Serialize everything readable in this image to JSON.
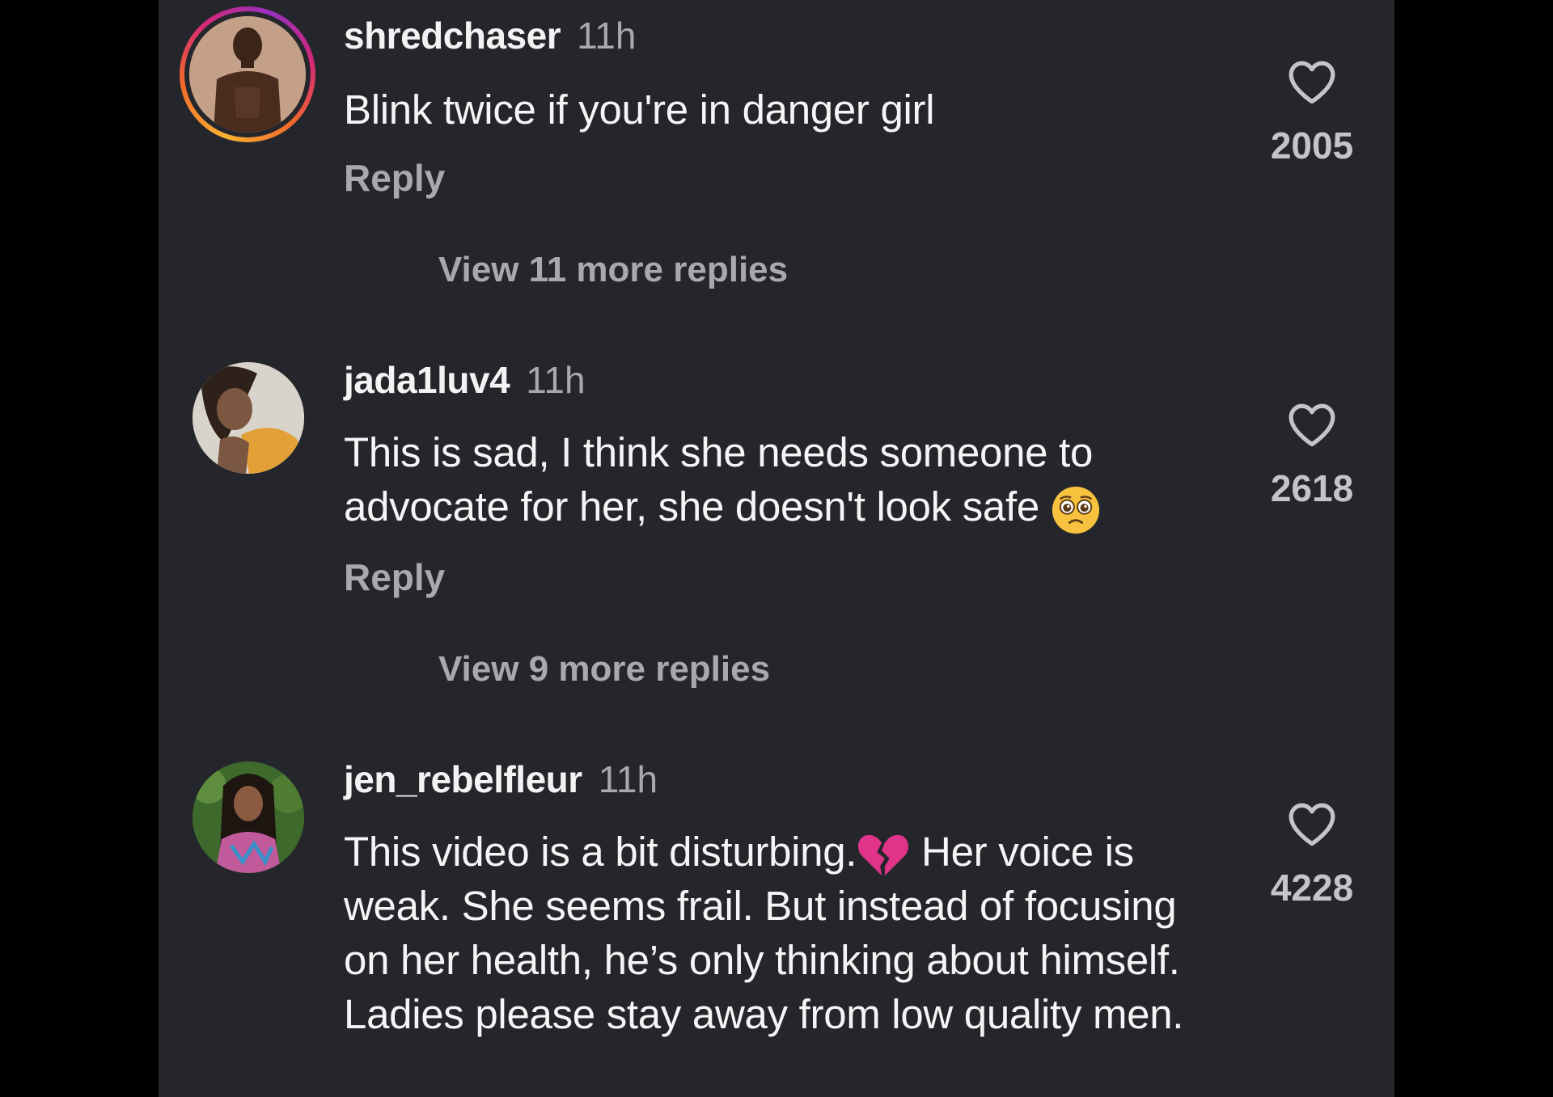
{
  "comments": [
    {
      "username": "shredchaser",
      "time": "11h",
      "text": "Blink twice if you're in danger girl",
      "reply_label": "Reply",
      "view_more": "View 11 more replies",
      "likes": "2005"
    },
    {
      "username": "jada1luv4",
      "time": "11h",
      "text_line1": "This is sad, I think she needs someone to",
      "text_line2": "advocate for her, she doesn't look safe",
      "emoji": "pleading-face",
      "reply_label": "Reply",
      "view_more": "View 9 more replies",
      "likes": "2618"
    },
    {
      "username": "jen_rebelfleur",
      "time": "11h",
      "text_part1": "This video is a bit disturbing.",
      "emoji": "broken-heart",
      "text_part2": " Her voice is weak. She seems frail. But instead of focusing on her health, he’s only thinking about himself. Ladies please stay away from low quality men.",
      "likes": "4228"
    }
  ],
  "icons": {
    "like": "heart-outline-icon"
  },
  "colors": {
    "panel_bg": "#25262b",
    "outer_bg": "#000000",
    "text_primary": "#f5f5f5",
    "text_secondary": "#a8a9ae"
  }
}
